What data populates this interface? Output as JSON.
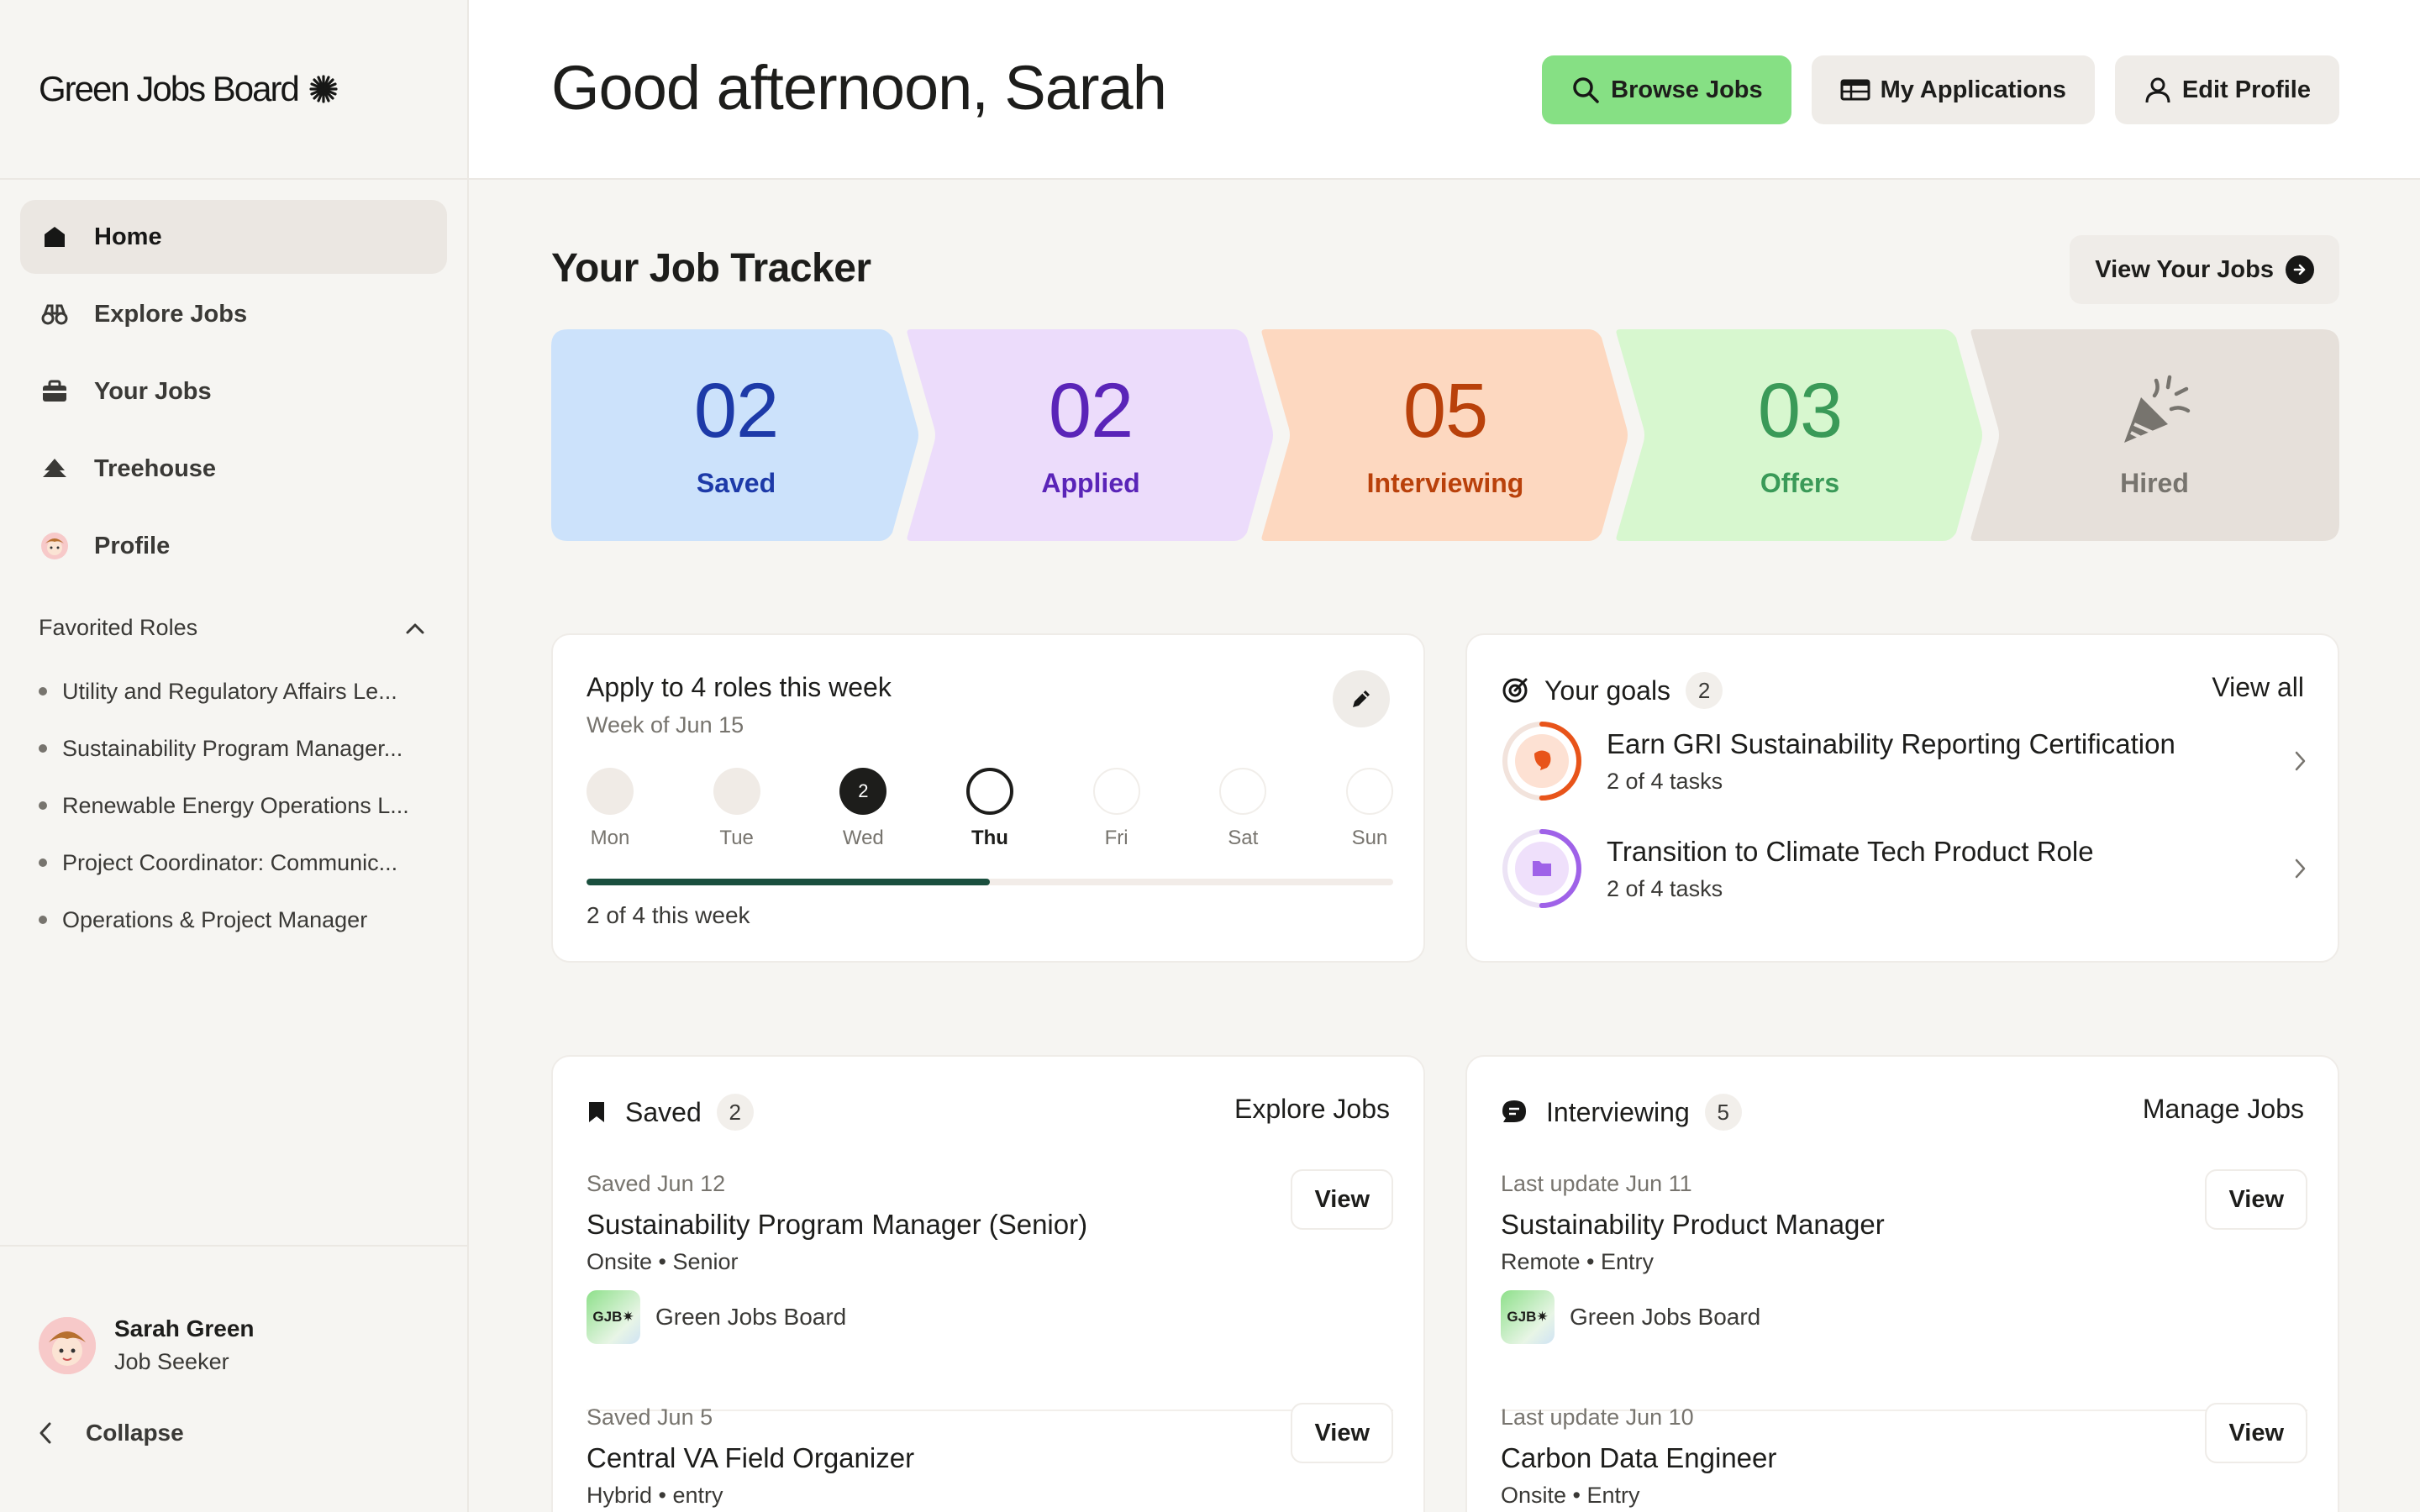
{
  "brand": {
    "name": "Green Jobs Board"
  },
  "sidebar": {
    "items": [
      {
        "label": "Home",
        "icon": "home-icon"
      },
      {
        "label": "Explore Jobs",
        "icon": "binoculars-icon"
      },
      {
        "label": "Your Jobs",
        "icon": "briefcase-icon"
      },
      {
        "label": "Treehouse",
        "icon": "tree-icon"
      },
      {
        "label": "Profile",
        "icon": "avatar-icon"
      }
    ],
    "favorites_title": "Favorited Roles",
    "favorites": [
      "Utility and Regulatory Affairs Le...",
      "Sustainability Program Manager...",
      "Renewable Energy Operations L...",
      "Project Coordinator: Communic...",
      "Operations & Project Manager"
    ],
    "user": {
      "name": "Sarah Green",
      "role": "Job Seeker"
    },
    "collapse_label": "Collapse"
  },
  "header": {
    "greeting": "Good afternoon, Sarah",
    "buttons": {
      "browse": "Browse Jobs",
      "applications": "My Applications",
      "profile": "Edit Profile"
    }
  },
  "tracker": {
    "title": "Your Job Tracker",
    "view_label": "View Your Jobs",
    "stages": [
      {
        "count": "02",
        "label": "Saved",
        "bg": "#cce2fb",
        "color": "#1d3aa8"
      },
      {
        "count": "02",
        "label": "Applied",
        "bg": "#ecdcfb",
        "color": "#5a24b8"
      },
      {
        "count": "05",
        "label": "Interviewing",
        "bg": "#fdd8c0",
        "color": "#b9410b"
      },
      {
        "count": "03",
        "label": "Offers",
        "bg": "#d7f7cf",
        "color": "#3a9a58"
      },
      {
        "count": "",
        "label": "Hired",
        "bg": "#e6e0da",
        "color": "#77746e"
      }
    ]
  },
  "weekly": {
    "title": "Apply to 4 roles this week",
    "subtitle": "Week of Jun 15",
    "days": [
      {
        "name": "Mon",
        "value": ""
      },
      {
        "name": "Tue",
        "value": ""
      },
      {
        "name": "Wed",
        "value": "2"
      },
      {
        "name": "Thu",
        "value": ""
      },
      {
        "name": "Fri",
        "value": ""
      },
      {
        "name": "Sat",
        "value": ""
      },
      {
        "name": "Sun",
        "value": ""
      }
    ],
    "progress_fraction": 0.5,
    "progress_text": "2 of 4 this week"
  },
  "goals": {
    "title": "Your goals",
    "count": "2",
    "view_all": "View all",
    "items": [
      {
        "title": "Earn GRI Sustainability Reporting Certification",
        "sub": "2 of 4 tasks",
        "color": "#e8541a",
        "progress": 0.5
      },
      {
        "title": "Transition to Climate Tech Product Role",
        "sub": "2 of 4 tasks",
        "color": "#9f62e8",
        "progress": 0.5
      }
    ]
  },
  "saved": {
    "title": "Saved",
    "count": "2",
    "link": "Explore Jobs",
    "jobs": [
      {
        "meta": "Saved Jun 12",
        "title": "Sustainability Program Manager (Senior)",
        "detail": "Onsite • Senior",
        "company": "Green Jobs Board",
        "logo": "GJB",
        "view": "View"
      },
      {
        "meta": "Saved Jun 5",
        "title": "Central VA Field Organizer",
        "detail": "Hybrid • entry",
        "view": "View"
      }
    ]
  },
  "interviewing": {
    "title": "Interviewing",
    "count": "5",
    "link": "Manage Jobs",
    "jobs": [
      {
        "meta": "Last update Jun 11",
        "title": "Sustainability Product Manager",
        "detail": "Remote • Entry",
        "company": "Green Jobs Board",
        "logo": "GJB",
        "view": "View"
      },
      {
        "meta": "Last update Jun 10",
        "title": "Carbon Data Engineer",
        "detail": "Onsite • Entry",
        "view": "View"
      }
    ]
  }
}
